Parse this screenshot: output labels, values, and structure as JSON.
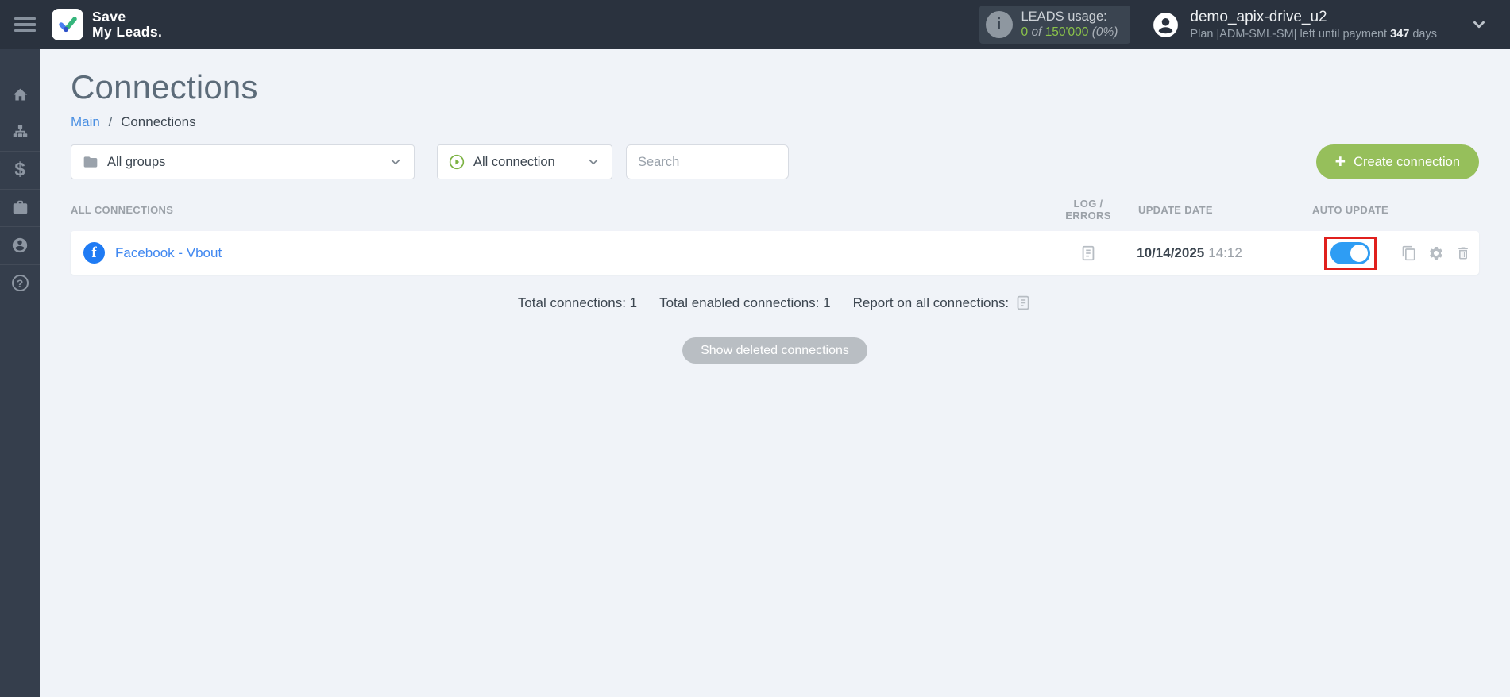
{
  "colors": {
    "header_bg": "#2a323e",
    "sidebar_bg": "#353e4c",
    "main_bg": "#f0f3f8",
    "toggle_blue": "#2e9df4",
    "link_blue": "#4a8fe2",
    "green_text": "#8bc34a",
    "create_button_green": "#96bf5b",
    "annotation_red": "#e0201d"
  },
  "icons": {
    "dollar": "$",
    "question": "?",
    "info": "i",
    "facebook": "f",
    "plus": "+"
  },
  "header": {
    "logo_line1": "Save",
    "logo_line2": "My Leads.",
    "leads": {
      "label": "LEADS usage:",
      "used": "0",
      "of_word": "of",
      "total": "150'000",
      "percent": "(0%)"
    },
    "user": {
      "name": "demo_apix-drive_u2",
      "plan_prefix": "Plan |ADM-SML-SM| left until payment",
      "days_value": "347",
      "days_word": "days"
    }
  },
  "sidebar": {
    "items": [
      {
        "icon": "home-icon"
      },
      {
        "icon": "hierarchy-icon"
      },
      {
        "icon": "dollar-icon"
      },
      {
        "icon": "briefcase-icon"
      },
      {
        "icon": "account-icon"
      },
      {
        "icon": "help-icon"
      }
    ]
  },
  "page": {
    "title": "Connections",
    "breadcrumb_root": "Main",
    "breadcrumb_separator": "/",
    "breadcrumb_current": "Connections"
  },
  "filters": {
    "groups_value": "All groups",
    "connection_value": "All connection",
    "search_placeholder": "Search",
    "create_button": "Create connection"
  },
  "table": {
    "headers": {
      "connections": "ALL CONNECTIONS",
      "log_errors": "LOG / ERRORS",
      "update_date": "UPDATE DATE",
      "auto_update": "AUTO UPDATE"
    },
    "rows": [
      {
        "name": "Facebook - Vbout",
        "date": "10/14/2025",
        "time": "14:12",
        "auto_update": true
      }
    ]
  },
  "summary": {
    "total": "Total connections: 1",
    "enabled": "Total enabled connections: 1",
    "report_label": "Report on all connections:"
  },
  "footer": {
    "show_deleted_button": "Show deleted connections"
  }
}
